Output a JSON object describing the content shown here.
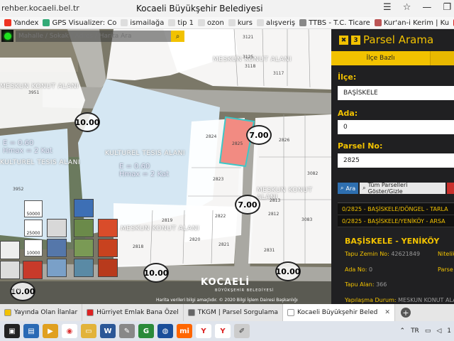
{
  "browser": {
    "url": "rehber.kocaeli.bel.tr",
    "window_title": "Kocaeli Büyükşehir Belediyesi"
  },
  "bookmarks": [
    {
      "label": "Yandex",
      "color": "#e32"
    },
    {
      "label": "GPS Visualizer: Co",
      "color": "#3a7"
    },
    {
      "label": "ismailağa",
      "color": "#ddd"
    },
    {
      "label": "tip 1",
      "color": "#ddd"
    },
    {
      "label": "ozon",
      "color": "#ddd"
    },
    {
      "label": "kurs",
      "color": "#ddd"
    },
    {
      "label": "alışveriş",
      "color": "#ddd"
    },
    {
      "label": "TTBS - T.C. Ticare",
      "color": "#888"
    },
    {
      "label": "Kur'an-i Kerim | Ku",
      "color": "#b55"
    },
    {
      "label": "Hürriyet Emlak - T",
      "color": "#d22"
    }
  ],
  "map": {
    "search_placeholder": "Mahalle / Sokak / Adres / Harita Ara",
    "attribution": "Harita verileri bilgi amaçlıdır. © 2020 Bilgi İşlem Dairesi Başkanlığı",
    "logo": "KOCAELİ",
    "logo_sub": "BÜYÜKŞEHİR BELEDİYESİ",
    "zones": {
      "meskun1": "MESKUN KONUT ALANI",
      "meskun2": "MESKUN KONUT ALANI",
      "meskun3": "MESKUN KONUT ALANI",
      "meskun4": "MESKUN KONUT ALANI",
      "kultur1": "KULTUREL TESIS ALANI",
      "kultur2": "KULTUREL TESIS ALANI",
      "e_left": "E = 0.60",
      "h_left": "Hmax = 2 Kat",
      "e_center": "E = 0.60",
      "h_center": "Hmax = 2 Kat"
    },
    "road_widths": {
      "r1": "10.00",
      "r2": "7.00",
      "r3": "7.00",
      "r4": "10.00",
      "r5": "10.00",
      "r6": "10.00"
    },
    "parcels": {
      "p3951": "3951",
      "p3952": "3952",
      "p3121": "3121",
      "p3125": "3125",
      "p3118": "3118",
      "p3117": "3117",
      "p2824": "2824",
      "p2825": "2825",
      "p2826": "2826",
      "p2823": "2823",
      "p2822": "2822",
      "p2821": "2821",
      "p2820": "2820",
      "p2819": "2819",
      "p2818": "2818",
      "p2813": "2813",
      "p2812": "2812",
      "p2831": "2831",
      "p3082": "3082",
      "p3083": "3083"
    },
    "scale_labels": [
      "50000",
      "25000",
      "10000"
    ],
    "corner_value": "1.00"
  },
  "panel": {
    "x_label": "✖",
    "n_label": "3",
    "title": "Parsel Arama",
    "tab_label": "İlçe Bazlı",
    "ilce_label": "İlçe:",
    "ilce_value": "BAŞİSKELE",
    "ada_label": "Ada:",
    "ada_value": "0",
    "parsel_label": "Parsel No:",
    "parsel_value": "2825",
    "btn_ara": "Ara",
    "btn_tum": "Tüm Parselleri Göster/Gizle",
    "results": [
      "0/2825 - BAŞİSKELE/DÖNGEL - TARLA",
      "0/2825 - BAŞİSKELE/YENİKÖY - ARSA"
    ],
    "detail_title": "BAŞİSKELE - YENİKÖY",
    "tapu_zemin_label": "Tapu Zemin No:",
    "tapu_zemin_value": "42621849",
    "nitelik_label": "Nitelik",
    "ada_no_label": "Ada No:",
    "ada_no_value": "0",
    "parsel_short": "Parse",
    "tapu_alan_label": "Tapu Alan:",
    "tapu_alan_value": "366",
    "yapilasma_label": "Yapılaşma Durum:",
    "yapilasma_value": "MESKUN KONUT ALA"
  },
  "tabs": [
    {
      "label": "Yayında Olan İlanlar",
      "color": "#f2c200",
      "active": false
    },
    {
      "label": "Hürriyet Emlak Bana Özel",
      "color": "#d22",
      "active": false
    },
    {
      "label": "TKGM | Parsel Sorgulama",
      "color": "#666",
      "active": false
    },
    {
      "label": "Kocaeli Büyükşehir Beled",
      "color": "#fff",
      "active": true
    }
  ],
  "taskbar": {
    "lang": "TR",
    "time": "1"
  }
}
